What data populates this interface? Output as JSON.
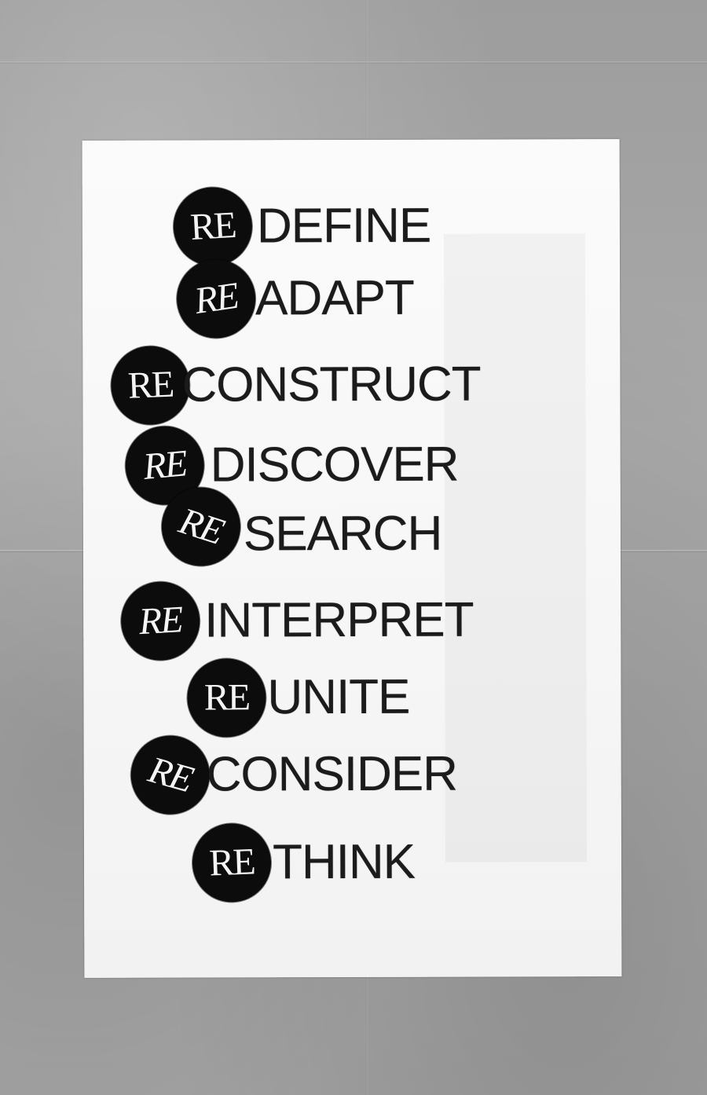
{
  "prefix": "RE",
  "words": [
    "DEFINE",
    "ADAPT",
    "CONSTRUCT",
    "DISCOVER",
    "SEARCH",
    "INTERPRET",
    "UNITE",
    "CONSIDER",
    "THINK"
  ],
  "colors": {
    "background": "#a4a4a4",
    "paper": "#f7f7f7",
    "seal": "#0c0c0c",
    "seal_text": "#f4f4f4",
    "word": "#1b1b1b"
  }
}
